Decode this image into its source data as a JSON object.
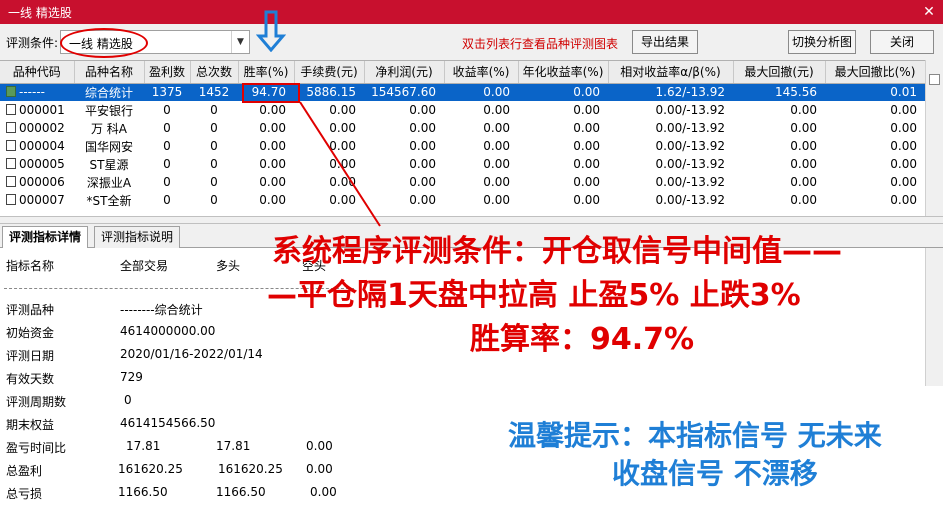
{
  "window": {
    "title": "一线 精选股",
    "close_symbol": "✕"
  },
  "toolbar": {
    "condition_label": "评测条件:",
    "condition_value": "一线 精选股",
    "hint": "双击列表行查看品种评测图表",
    "export_label": "导出结果",
    "switch_label": "切换分析图",
    "close_label": "关闭"
  },
  "grid": {
    "columns": [
      "品种代码",
      "品种名称",
      "盈利数",
      "总次数",
      "胜率(%)",
      "手续费(元)",
      "净利润(元)",
      "收益率(%)",
      "年化收益率(%)",
      "相对收益率α/β(%)",
      "最大回撤(元)",
      "最大回撤比(%)"
    ],
    "rows": [
      {
        "code": "------",
        "name": "综合统计",
        "win": "1375",
        "total": "1452",
        "rate": "94.70",
        "fee": "5886.15",
        "profit": "154567.60",
        "ret": "0.00",
        "annual": "0.00",
        "relative": "1.62/-13.92",
        "maxdd": "145.56",
        "maxddr": "0.01",
        "selected": true
      },
      {
        "code": "000001",
        "name": "平安银行",
        "win": "0",
        "total": "0",
        "rate": "0.00",
        "fee": "0.00",
        "profit": "0.00",
        "ret": "0.00",
        "annual": "0.00",
        "relative": "0.00/-13.92",
        "maxdd": "0.00",
        "maxddr": "0.00"
      },
      {
        "code": "000002",
        "name": "万 科A",
        "win": "0",
        "total": "0",
        "rate": "0.00",
        "fee": "0.00",
        "profit": "0.00",
        "ret": "0.00",
        "annual": "0.00",
        "relative": "0.00/-13.92",
        "maxdd": "0.00",
        "maxddr": "0.00"
      },
      {
        "code": "000004",
        "name": "国华网安",
        "win": "0",
        "total": "0",
        "rate": "0.00",
        "fee": "0.00",
        "profit": "0.00",
        "ret": "0.00",
        "annual": "0.00",
        "relative": "0.00/-13.92",
        "maxdd": "0.00",
        "maxddr": "0.00"
      },
      {
        "code": "000005",
        "name": "ST星源",
        "win": "0",
        "total": "0",
        "rate": "0.00",
        "fee": "0.00",
        "profit": "0.00",
        "ret": "0.00",
        "annual": "0.00",
        "relative": "0.00/-13.92",
        "maxdd": "0.00",
        "maxddr": "0.00"
      },
      {
        "code": "000006",
        "name": "深振业A",
        "win": "0",
        "total": "0",
        "rate": "0.00",
        "fee": "0.00",
        "profit": "0.00",
        "ret": "0.00",
        "annual": "0.00",
        "relative": "0.00/-13.92",
        "maxdd": "0.00",
        "maxddr": "0.00"
      },
      {
        "code": "000007",
        "name": "*ST全新",
        "win": "0",
        "total": "0",
        "rate": "0.00",
        "fee": "0.00",
        "profit": "0.00",
        "ret": "0.00",
        "annual": "0.00",
        "relative": "0.00/-13.92",
        "maxdd": "0.00",
        "maxddr": "0.00"
      }
    ]
  },
  "tabs": [
    "评测指标详情",
    "评测指标说明"
  ],
  "detail": {
    "header": [
      "指标名称",
      "全部交易",
      "多头",
      "空头"
    ],
    "rows": [
      {
        "name": "评测品种",
        "all": "--------综合统计",
        "long": "",
        "short": ""
      },
      {
        "name": "初始资金",
        "all": "4614000000.00",
        "long": "",
        "short": ""
      },
      {
        "name": "评测日期",
        "all": "2020/01/16-2022/01/14",
        "long": "",
        "short": ""
      },
      {
        "name": "有效天数",
        "all": "729",
        "long": "",
        "short": ""
      },
      {
        "name": "评测周期数",
        "all": "0",
        "long": "",
        "short": ""
      },
      {
        "name": "期末权益",
        "all": "4614154566.50",
        "long": "",
        "short": ""
      },
      {
        "name": "盈亏时间比",
        "all": "17.81",
        "long": "17.81",
        "short": "0.00"
      },
      {
        "name": "总盈利",
        "all": "161620.25",
        "long": "161620.25",
        "short": "0.00"
      },
      {
        "name": "总亏损",
        "all": "1166.50",
        "long": "1166.50",
        "short": "0.00"
      }
    ]
  },
  "annotation": {
    "line1": "系统程序评测条件：开仓取信号中间值——",
    "line2": "—平仓隔1天盘中拉高  止盈5%  止跌3%",
    "line3": "胜算率：94.7%",
    "tip1": "温馨提示：本指标信号 无未来",
    "tip2": "收盘信号 不漂移"
  },
  "colors": {
    "titlebar": "#c8102e",
    "selection": "#0a64c8",
    "annotation_red": "#e00000",
    "annotation_blue": "#1f7fd6"
  },
  "icons": [
    "close-icon",
    "dropdown-arrow-icon",
    "blue-down-arrow-icon",
    "checkbox-icon"
  ]
}
